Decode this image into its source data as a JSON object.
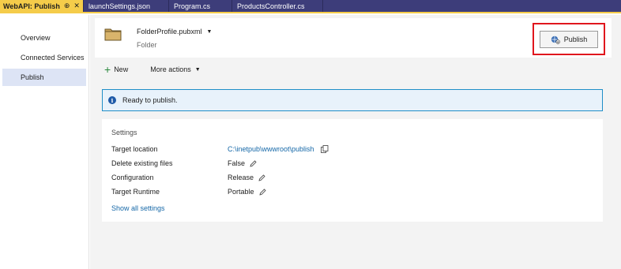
{
  "tabs": [
    {
      "label": "WebAPI: Publish",
      "pin": "⊕",
      "close": "✕",
      "active": true
    },
    {
      "label": "launchSettings.json",
      "active": false
    },
    {
      "label": "Program.cs",
      "active": false
    },
    {
      "label": "ProductsController.cs",
      "active": false
    }
  ],
  "sidebar": {
    "items": [
      {
        "label": "Overview",
        "active": false
      },
      {
        "label": "Connected Services",
        "active": false
      },
      {
        "label": "Publish",
        "active": true
      }
    ]
  },
  "profile": {
    "name": "FolderProfile.pubxml",
    "caret": "▼",
    "type": "Folder",
    "icon": "folder-icon"
  },
  "publish_button": {
    "label": "Publish",
    "icon": "publish-globe-icon"
  },
  "actions": {
    "new_label": "New",
    "new_icon": "+",
    "more_label": "More actions",
    "more_caret": "▼"
  },
  "info": {
    "icon": "i",
    "message": "Ready to publish."
  },
  "settings": {
    "title": "Settings",
    "rows": [
      {
        "label": "Target location",
        "value": "C:\\inetpub\\wwwroot\\publish",
        "action_icon": "copy-icon"
      },
      {
        "label": "Delete existing files",
        "value": "False",
        "action_icon": "pencil-icon"
      },
      {
        "label": "Configuration",
        "value": "Release",
        "action_icon": "pencil-icon"
      },
      {
        "label": "Target Runtime",
        "value": "Portable",
        "action_icon": "pencil-icon"
      }
    ],
    "show_all_label": "Show all settings"
  },
  "colors": {
    "tab_strip": "#3d3d7a",
    "active_tab": "#f5cc4a",
    "highlight": "#e0161d",
    "link": "#1668a8",
    "info_border": "#1f8ec7",
    "nav_active": "#dde4f5"
  }
}
